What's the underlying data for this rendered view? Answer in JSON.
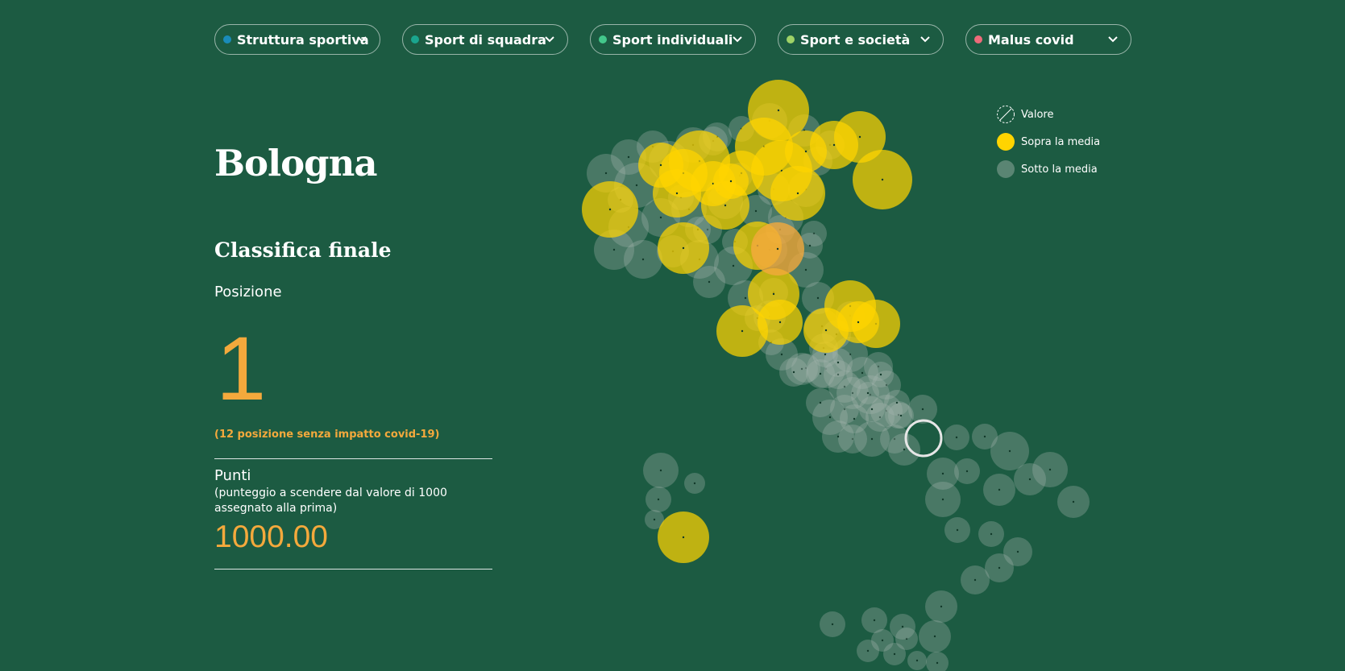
{
  "filters": [
    {
      "label": "Struttura sportiva",
      "color": "#1a8cba"
    },
    {
      "label": "Sport di squadra",
      "color": "#1aa58e"
    },
    {
      "label": "Sport individuali",
      "color": "#43c78b"
    },
    {
      "label": "Sport e società",
      "color": "#9ed267"
    },
    {
      "label": "Malus covid",
      "color": "#ee6b7a"
    }
  ],
  "city": "Bologna",
  "ranking": {
    "title": "Classifica finale",
    "position_label": "Posizione",
    "position": "1",
    "note": "(12 posizione senza impatto covid-19)",
    "points_label": "Punti",
    "points_description": "(punteggio a scendere dal valore di 1000 assegnato alla prima)",
    "points": "1000.00"
  },
  "legend": {
    "value": "Valore",
    "above": "Sopra la media",
    "below": "Sotto la media"
  },
  "colors": {
    "background": "#1c5b42",
    "above_average": "#ffd400",
    "below_average": "#a7b9b0",
    "highlight": "#f4a93c"
  }
}
